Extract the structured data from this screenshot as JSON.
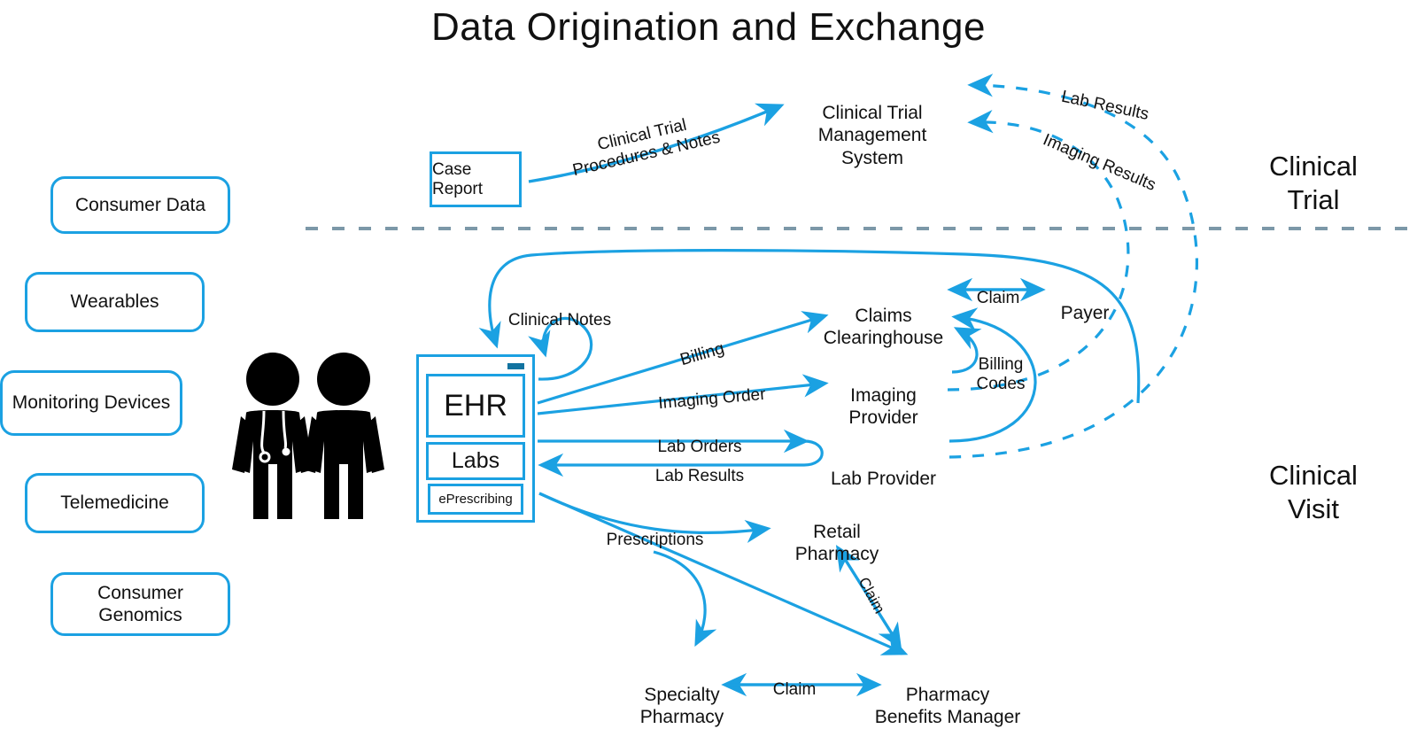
{
  "title": "Data Origination and Exchange",
  "colors": {
    "accent": "#1BA1E2",
    "divider": "#7c98a8",
    "figure": "#000000",
    "text": "#111111"
  },
  "sections": [
    {
      "label": "Clinical\nTrial"
    },
    {
      "label": "Clinical\nVisit"
    }
  ],
  "sources": [
    {
      "label": "Consumer Data"
    },
    {
      "label": "Wearables"
    },
    {
      "label": "Monitoring\nDevices"
    },
    {
      "label": "Telemedicine"
    },
    {
      "label": "Consumer\nGenomics"
    }
  ],
  "actors": {
    "clinician": "clinician-figure",
    "patient": "patient-figure"
  },
  "ehr": {
    "primary": "EHR",
    "labs": "Labs",
    "eprescribing": "ePrescribing"
  },
  "nodes": {
    "case_report": "Case Report",
    "ctms": "Clinical Trial\nManagement\nSystem",
    "claims_clearinghouse": "Claims\nClearinghouse",
    "payer": "Payer",
    "imaging_provider": "Imaging\nProvider",
    "lab_provider": "Lab Provider",
    "retail_pharmacy": "Retail\nPharmacy",
    "specialty_pharmacy": "Specialty\nPharmacy",
    "pbm": "Pharmacy\nBenefits Manager"
  },
  "edges": {
    "clinical_trial_procedures": "Clinical Trial\nProcedures & Notes",
    "lab_results_trial": "Lab Results",
    "imaging_results_trial": "Imaging Results",
    "clinical_notes": "Clinical Notes",
    "billing": "Billing",
    "imaging_order": "Imaging Order",
    "lab_orders": "Lab Orders",
    "lab_results": "Lab Results",
    "claim_payer": "Claim",
    "billing_codes": "Billing\nCodes",
    "prescriptions": "Prescriptions",
    "claim_retail": "Claim",
    "claim_specialty": "Claim"
  }
}
